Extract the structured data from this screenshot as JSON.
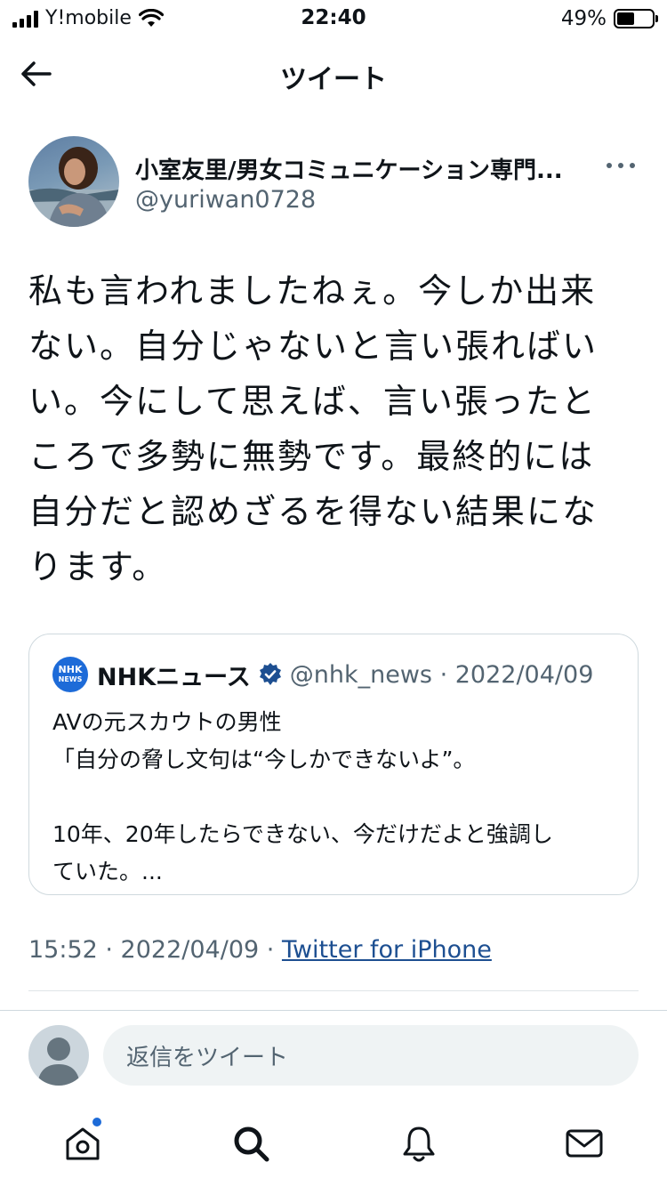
{
  "status_bar": {
    "carrier": "Y!mobile",
    "time": "22:40",
    "battery": "49%",
    "battery_level": 0.49
  },
  "header": {
    "title": "ツイート"
  },
  "tweet": {
    "author_name": "小室友里/男女コミュニケーション専門...",
    "author_handle": "@yuriwan0728",
    "body_lines": [
      "私も言われましたねぇ。今しか出来",
      "ない。自分じゃないと言い張ればい",
      "い。今にして思えば、言い張ったと",
      "ころで多勢に無勢です。最終的には",
      "自分だと認めざるを得ない結果にな",
      "ります。"
    ],
    "quote": {
      "logo_text": [
        "NHK",
        "NEWS"
      ],
      "name": "NHKニュース",
      "handle_date": "@nhk_news · 2022/04/09",
      "lines": [
        "AVの元スカウトの男性",
        "「自分の脅し文句は“今しかできないよ”。",
        "",
        "10年、20年したらできない、今だけだよと強調し",
        "ていた。..."
      ]
    },
    "meta_time": "15:52 · 2022/04/09 · ",
    "meta_source": "Twitter for iPhone"
  },
  "reply": {
    "placeholder": "返信をツイート"
  },
  "tab_bar": {
    "items": [
      "home-icon",
      "search-icon",
      "notifications-icon",
      "messages-icon"
    ]
  }
}
